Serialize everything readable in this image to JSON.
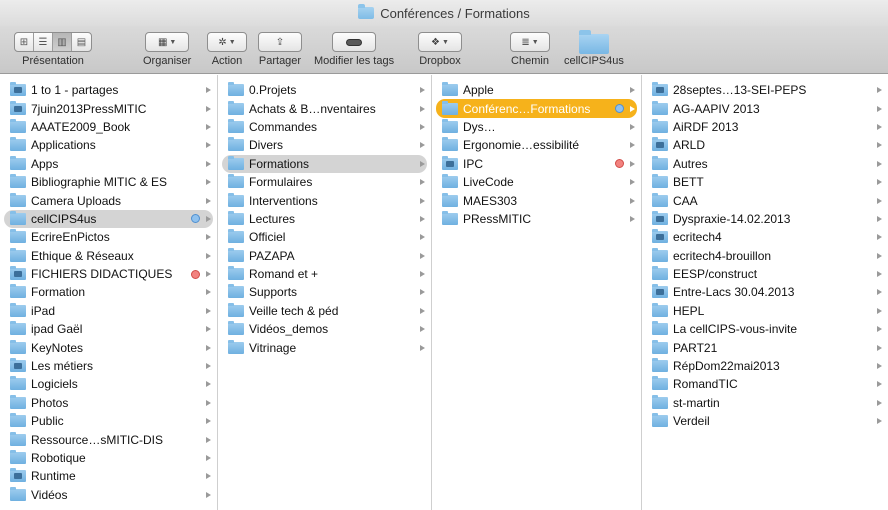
{
  "window": {
    "title": "Conférences / Formations"
  },
  "toolbar": {
    "presentation_label": "Présentation",
    "organiser_label": "Organiser",
    "action_label": "Action",
    "partager_label": "Partager",
    "tags_label": "Modifier les tags",
    "dropbox_label": "Dropbox",
    "chemin_label": "Chemin",
    "folder_label": "cellCIPS4us"
  },
  "columns": [
    {
      "items": [
        {
          "label": "1 to 1 - partages",
          "icon": "shared-folder-icon"
        },
        {
          "label": "7juin2013PressMITIC",
          "icon": "shared-folder-icon"
        },
        {
          "label": "AAATE2009_Book",
          "icon": "folder-icon"
        },
        {
          "label": "Applications",
          "icon": "folder-icon"
        },
        {
          "label": "Apps",
          "icon": "folder-icon"
        },
        {
          "label": "Bibliographie MITIC & ES",
          "icon": "folder-icon"
        },
        {
          "label": "Camera Uploads",
          "icon": "folder-icon"
        },
        {
          "label": "cellCIPS4us",
          "icon": "folder-icon",
          "selected": "gray",
          "tag": "blue"
        },
        {
          "label": "EcrireEnPictos",
          "icon": "folder-icon"
        },
        {
          "label": "Ethique & Réseaux",
          "icon": "folder-icon"
        },
        {
          "label": "FICHIERS DIDACTIQUES",
          "icon": "shared-folder-icon",
          "tag": "red"
        },
        {
          "label": "Formation",
          "icon": "folder-icon"
        },
        {
          "label": "iPad",
          "icon": "folder-icon"
        },
        {
          "label": "ipad Gaël",
          "icon": "folder-icon"
        },
        {
          "label": "KeyNotes",
          "icon": "folder-icon"
        },
        {
          "label": "Les métiers",
          "icon": "shared-folder-icon"
        },
        {
          "label": "Logiciels",
          "icon": "folder-icon"
        },
        {
          "label": "Photos",
          "icon": "folder-icon"
        },
        {
          "label": "Public",
          "icon": "folder-icon"
        },
        {
          "label": "Ressource…sMITIC-DIS",
          "icon": "folder-icon"
        },
        {
          "label": "Robotique",
          "icon": "folder-icon"
        },
        {
          "label": "Runtime",
          "icon": "shared-folder-icon"
        },
        {
          "label": "Vidéos",
          "icon": "folder-icon"
        }
      ]
    },
    {
      "items": [
        {
          "label": "0.Projets",
          "icon": "folder-icon"
        },
        {
          "label": "Achats & B…nventaires",
          "icon": "folder-icon"
        },
        {
          "label": "Commandes",
          "icon": "folder-icon"
        },
        {
          "label": "Divers",
          "icon": "folder-icon"
        },
        {
          "label": "Formations",
          "icon": "folder-icon",
          "selected": "gray"
        },
        {
          "label": "Formulaires",
          "icon": "folder-icon"
        },
        {
          "label": "Interventions",
          "icon": "folder-icon"
        },
        {
          "label": "Lectures",
          "icon": "folder-icon"
        },
        {
          "label": "Officiel",
          "icon": "folder-icon"
        },
        {
          "label": "PAZAPA",
          "icon": "folder-icon"
        },
        {
          "label": "Romand et +",
          "icon": "folder-icon"
        },
        {
          "label": "Supports",
          "icon": "folder-icon"
        },
        {
          "label": "Veille tech & péd",
          "icon": "folder-icon"
        },
        {
          "label": "Vidéos_demos",
          "icon": "folder-icon"
        },
        {
          "label": "Vitrinage",
          "icon": "folder-icon"
        }
      ]
    },
    {
      "items": [
        {
          "label": "Apple",
          "icon": "folder-icon"
        },
        {
          "label": "Conférenc…Formations",
          "icon": "folder-icon",
          "selected": "orange",
          "tag": "blue"
        },
        {
          "label": "Dys…",
          "icon": "folder-icon"
        },
        {
          "label": "Ergonomie…essibilité",
          "icon": "folder-icon"
        },
        {
          "label": "IPC",
          "icon": "shared-folder-icon",
          "tag": "red"
        },
        {
          "label": "LiveCode",
          "icon": "folder-icon"
        },
        {
          "label": "MAES303",
          "icon": "folder-icon"
        },
        {
          "label": "PRessMITIC",
          "icon": "folder-icon"
        }
      ]
    },
    {
      "items": [
        {
          "label": "28septes…13-SEI-PEPS",
          "icon": "shared-folder-icon"
        },
        {
          "label": "AG-AAPIV 2013",
          "icon": "folder-icon"
        },
        {
          "label": "AiRDF 2013",
          "icon": "folder-icon"
        },
        {
          "label": "ARLD",
          "icon": "shared-folder-icon"
        },
        {
          "label": "Autres",
          "icon": "folder-icon"
        },
        {
          "label": "BETT",
          "icon": "folder-icon"
        },
        {
          "label": "CAA",
          "icon": "folder-icon"
        },
        {
          "label": "Dyspraxie-14.02.2013",
          "icon": "shared-folder-icon"
        },
        {
          "label": "ecritech4",
          "icon": "shared-folder-icon"
        },
        {
          "label": "ecritech4-brouillon",
          "icon": "folder-icon"
        },
        {
          "label": "EESP/construct",
          "icon": "folder-icon"
        },
        {
          "label": "Entre-Lacs 30.04.2013",
          "icon": "shared-folder-icon"
        },
        {
          "label": "HEPL",
          "icon": "folder-icon"
        },
        {
          "label": "La cellCIPS-vous-invite",
          "icon": "folder-icon"
        },
        {
          "label": "PART21",
          "icon": "folder-icon"
        },
        {
          "label": "RépDom22mai2013",
          "icon": "folder-icon"
        },
        {
          "label": "RomandTIC",
          "icon": "folder-icon"
        },
        {
          "label": "st-martin",
          "icon": "folder-icon"
        },
        {
          "label": "Verdeil",
          "icon": "folder-icon"
        }
      ]
    }
  ]
}
